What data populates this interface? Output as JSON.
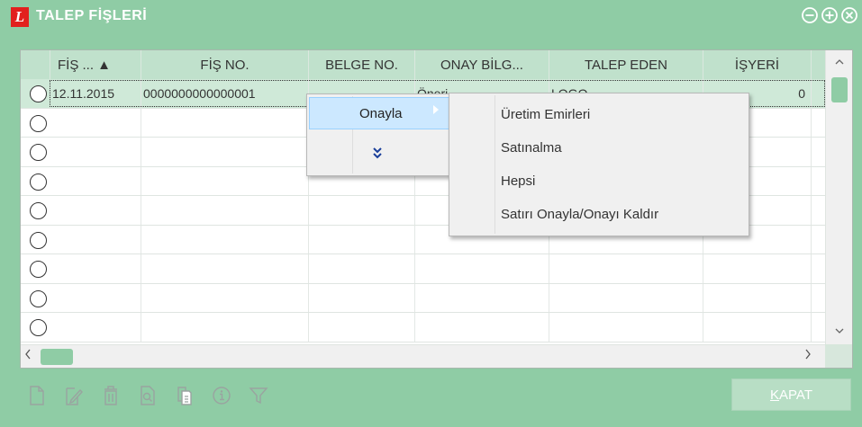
{
  "window": {
    "title": "TALEP FİŞLERİ",
    "logo": "L",
    "controls": [
      "minimize-circle-icon",
      "maximize-circle-icon",
      "close-circle-icon"
    ]
  },
  "grid": {
    "columns": [
      {
        "label": "FİŞ ... ▲"
      },
      {
        "label": "FİŞ NO."
      },
      {
        "label": "BELGE NO."
      },
      {
        "label": "ONAY BİLG..."
      },
      {
        "label": "TALEP EDEN"
      },
      {
        "label": "İŞYERİ"
      }
    ],
    "rows": [
      {
        "date": "12.11.2015",
        "fis_no": "0000000000000001",
        "belge_no": "",
        "onay": "Öneri",
        "talep_eden": "LOGO",
        "isyeri": "0"
      },
      {
        "date": "",
        "fis_no": "",
        "belge_no": "",
        "onay": "",
        "talep_eden": "",
        "isyeri": ""
      },
      {
        "date": "",
        "fis_no": "",
        "belge_no": "",
        "onay": "",
        "talep_eden": "",
        "isyeri": ""
      },
      {
        "date": "",
        "fis_no": "",
        "belge_no": "",
        "onay": "",
        "talep_eden": "",
        "isyeri": ""
      },
      {
        "date": "",
        "fis_no": "",
        "belge_no": "",
        "onay": "",
        "talep_eden": "",
        "isyeri": ""
      },
      {
        "date": "",
        "fis_no": "",
        "belge_no": "",
        "onay": "",
        "talep_eden": "",
        "isyeri": ""
      },
      {
        "date": "",
        "fis_no": "",
        "belge_no": "",
        "onay": "",
        "talep_eden": "",
        "isyeri": ""
      },
      {
        "date": "",
        "fis_no": "",
        "belge_no": "",
        "onay": "",
        "talep_eden": "",
        "isyeri": ""
      },
      {
        "date": "",
        "fis_no": "",
        "belge_no": "",
        "onay": "",
        "talep_eden": "",
        "isyeri": ""
      }
    ]
  },
  "context_menu": {
    "item": "Onayla",
    "more_icon": "double-chevron-down-icon"
  },
  "submenu": {
    "items": [
      "Üretim Emirleri",
      "Satınalma",
      "Hepsi",
      "Satırı Onayla/Onayı Kaldır"
    ]
  },
  "toolbar": {
    "icons": [
      "new-document-icon",
      "edit-document-icon",
      "delete-icon",
      "preview-icon",
      "copy-icon",
      "info-icon",
      "filter-icon"
    ]
  },
  "buttons": {
    "close_prefix": "",
    "close_accel": "K",
    "close_rest": "APAT"
  },
  "colors": {
    "accent": "#8fcca5",
    "header_bg": "#c0e1cc",
    "logo_red": "#e2201e"
  }
}
